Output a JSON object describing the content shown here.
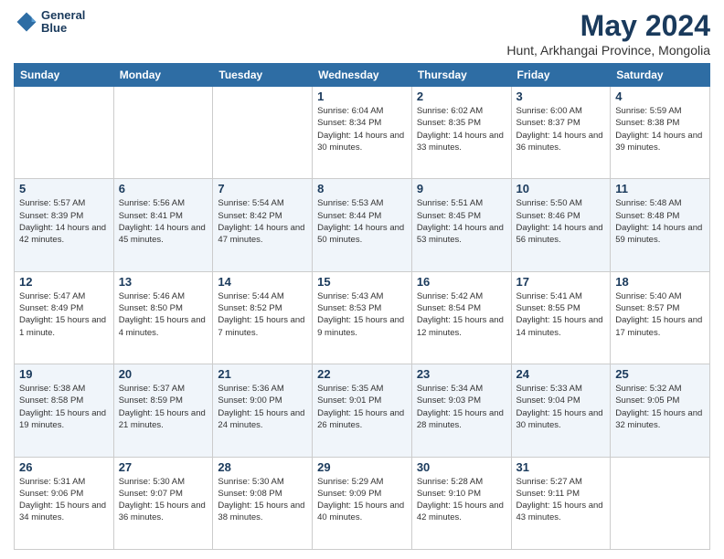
{
  "header": {
    "logo_line1": "General",
    "logo_line2": "Blue",
    "title": "May 2024",
    "subtitle": "Hunt, Arkhangai Province, Mongolia"
  },
  "weekdays": [
    "Sunday",
    "Monday",
    "Tuesday",
    "Wednesday",
    "Thursday",
    "Friday",
    "Saturday"
  ],
  "weeks": [
    [
      {
        "day": "",
        "info": ""
      },
      {
        "day": "",
        "info": ""
      },
      {
        "day": "",
        "info": ""
      },
      {
        "day": "1",
        "info": "Sunrise: 6:04 AM\nSunset: 8:34 PM\nDaylight: 14 hours\nand 30 minutes."
      },
      {
        "day": "2",
        "info": "Sunrise: 6:02 AM\nSunset: 8:35 PM\nDaylight: 14 hours\nand 33 minutes."
      },
      {
        "day": "3",
        "info": "Sunrise: 6:00 AM\nSunset: 8:37 PM\nDaylight: 14 hours\nand 36 minutes."
      },
      {
        "day": "4",
        "info": "Sunrise: 5:59 AM\nSunset: 8:38 PM\nDaylight: 14 hours\nand 39 minutes."
      }
    ],
    [
      {
        "day": "5",
        "info": "Sunrise: 5:57 AM\nSunset: 8:39 PM\nDaylight: 14 hours\nand 42 minutes."
      },
      {
        "day": "6",
        "info": "Sunrise: 5:56 AM\nSunset: 8:41 PM\nDaylight: 14 hours\nand 45 minutes."
      },
      {
        "day": "7",
        "info": "Sunrise: 5:54 AM\nSunset: 8:42 PM\nDaylight: 14 hours\nand 47 minutes."
      },
      {
        "day": "8",
        "info": "Sunrise: 5:53 AM\nSunset: 8:44 PM\nDaylight: 14 hours\nand 50 minutes."
      },
      {
        "day": "9",
        "info": "Sunrise: 5:51 AM\nSunset: 8:45 PM\nDaylight: 14 hours\nand 53 minutes."
      },
      {
        "day": "10",
        "info": "Sunrise: 5:50 AM\nSunset: 8:46 PM\nDaylight: 14 hours\nand 56 minutes."
      },
      {
        "day": "11",
        "info": "Sunrise: 5:48 AM\nSunset: 8:48 PM\nDaylight: 14 hours\nand 59 minutes."
      }
    ],
    [
      {
        "day": "12",
        "info": "Sunrise: 5:47 AM\nSunset: 8:49 PM\nDaylight: 15 hours\nand 1 minute."
      },
      {
        "day": "13",
        "info": "Sunrise: 5:46 AM\nSunset: 8:50 PM\nDaylight: 15 hours\nand 4 minutes."
      },
      {
        "day": "14",
        "info": "Sunrise: 5:44 AM\nSunset: 8:52 PM\nDaylight: 15 hours\nand 7 minutes."
      },
      {
        "day": "15",
        "info": "Sunrise: 5:43 AM\nSunset: 8:53 PM\nDaylight: 15 hours\nand 9 minutes."
      },
      {
        "day": "16",
        "info": "Sunrise: 5:42 AM\nSunset: 8:54 PM\nDaylight: 15 hours\nand 12 minutes."
      },
      {
        "day": "17",
        "info": "Sunrise: 5:41 AM\nSunset: 8:55 PM\nDaylight: 15 hours\nand 14 minutes."
      },
      {
        "day": "18",
        "info": "Sunrise: 5:40 AM\nSunset: 8:57 PM\nDaylight: 15 hours\nand 17 minutes."
      }
    ],
    [
      {
        "day": "19",
        "info": "Sunrise: 5:38 AM\nSunset: 8:58 PM\nDaylight: 15 hours\nand 19 minutes."
      },
      {
        "day": "20",
        "info": "Sunrise: 5:37 AM\nSunset: 8:59 PM\nDaylight: 15 hours\nand 21 minutes."
      },
      {
        "day": "21",
        "info": "Sunrise: 5:36 AM\nSunset: 9:00 PM\nDaylight: 15 hours\nand 24 minutes."
      },
      {
        "day": "22",
        "info": "Sunrise: 5:35 AM\nSunset: 9:01 PM\nDaylight: 15 hours\nand 26 minutes."
      },
      {
        "day": "23",
        "info": "Sunrise: 5:34 AM\nSunset: 9:03 PM\nDaylight: 15 hours\nand 28 minutes."
      },
      {
        "day": "24",
        "info": "Sunrise: 5:33 AM\nSunset: 9:04 PM\nDaylight: 15 hours\nand 30 minutes."
      },
      {
        "day": "25",
        "info": "Sunrise: 5:32 AM\nSunset: 9:05 PM\nDaylight: 15 hours\nand 32 minutes."
      }
    ],
    [
      {
        "day": "26",
        "info": "Sunrise: 5:31 AM\nSunset: 9:06 PM\nDaylight: 15 hours\nand 34 minutes."
      },
      {
        "day": "27",
        "info": "Sunrise: 5:30 AM\nSunset: 9:07 PM\nDaylight: 15 hours\nand 36 minutes."
      },
      {
        "day": "28",
        "info": "Sunrise: 5:30 AM\nSunset: 9:08 PM\nDaylight: 15 hours\nand 38 minutes."
      },
      {
        "day": "29",
        "info": "Sunrise: 5:29 AM\nSunset: 9:09 PM\nDaylight: 15 hours\nand 40 minutes."
      },
      {
        "day": "30",
        "info": "Sunrise: 5:28 AM\nSunset: 9:10 PM\nDaylight: 15 hours\nand 42 minutes."
      },
      {
        "day": "31",
        "info": "Sunrise: 5:27 AM\nSunset: 9:11 PM\nDaylight: 15 hours\nand 43 minutes."
      },
      {
        "day": "",
        "info": ""
      }
    ]
  ]
}
